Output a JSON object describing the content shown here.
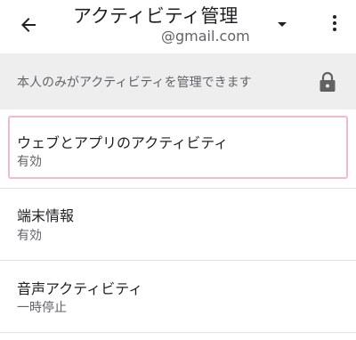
{
  "header": {
    "title": "アクティビティ管理",
    "account_email": "@gmail.com"
  },
  "banner": {
    "text": "本人のみがアクティビティを管理できます"
  },
  "items": [
    {
      "title": "ウェブとアプリのアクティビティ",
      "status": "有効"
    },
    {
      "title": "端末情報",
      "status": "有効"
    },
    {
      "title": "音声アクティビティ",
      "status": "一時停止"
    }
  ],
  "icons": {
    "back": "arrow-back-icon",
    "dropdown": "arrow-drop-down-icon",
    "more": "more-vert-icon",
    "lock": "lock-icon"
  },
  "colors": {
    "banner_background": "#eeeeee",
    "focus_ring": "#f3b8d2",
    "primary_text": "#202124",
    "secondary_text": "#5f6368",
    "divider": "#e0e0e0"
  }
}
